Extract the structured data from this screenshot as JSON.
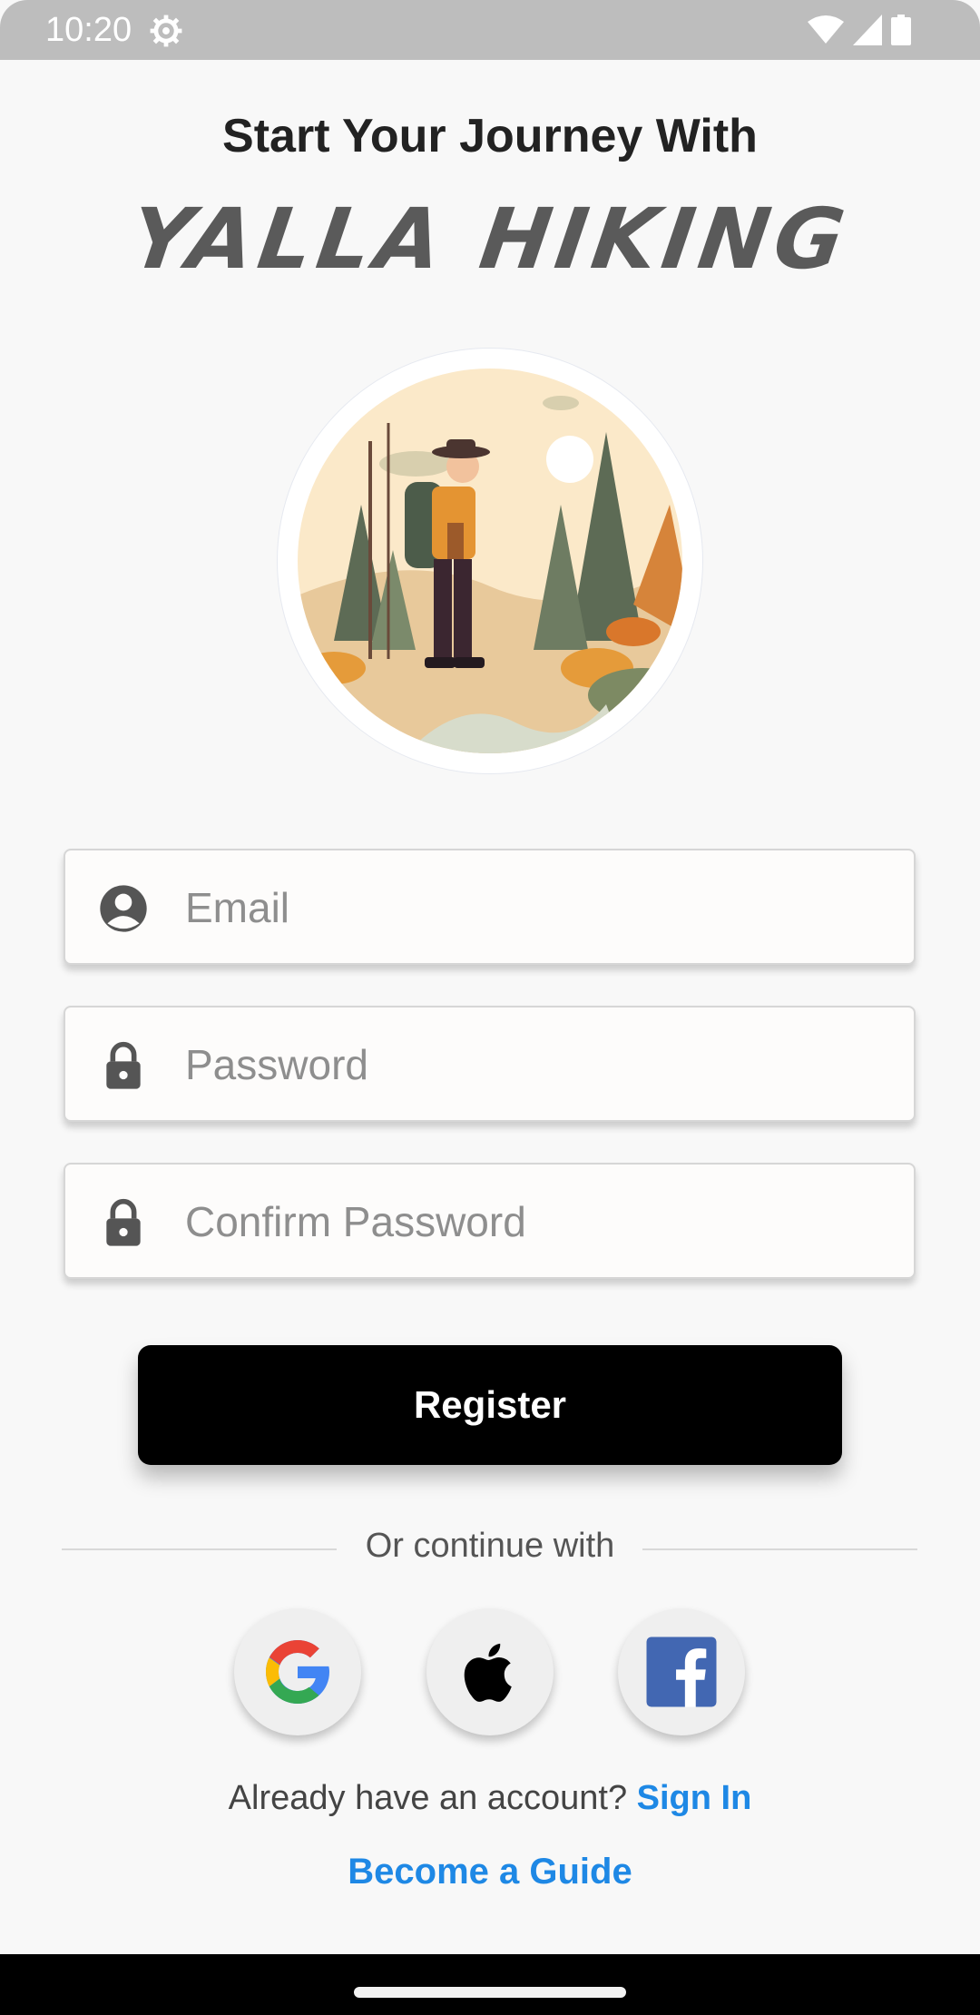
{
  "status_bar": {
    "time": "10:20"
  },
  "header": {
    "title": "Start Your Journey With",
    "brand": "YALLA HIKING"
  },
  "form": {
    "email_placeholder": "Email",
    "password_placeholder": "Password",
    "confirm_password_placeholder": "Confirm Password",
    "register_label": "Register"
  },
  "social": {
    "divider_text": "Or continue with",
    "providers": [
      "google-icon",
      "apple-icon",
      "facebook-icon"
    ]
  },
  "footer": {
    "account_prompt": "Already have an account?",
    "sign_in_label": "Sign In",
    "guide_label": "Become a Guide"
  },
  "colors": {
    "link": "#1e88e5",
    "button_bg": "#000000",
    "background": "#f8f8f8"
  }
}
